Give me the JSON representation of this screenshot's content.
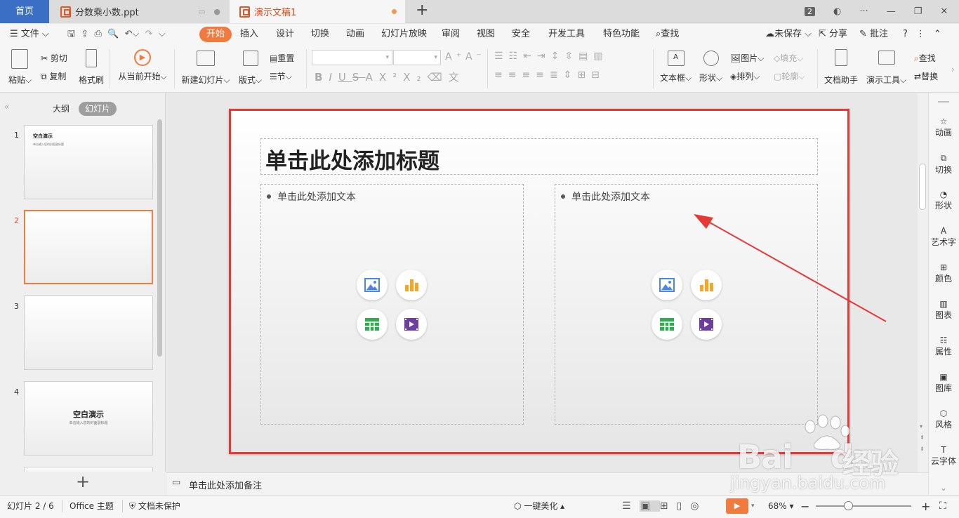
{
  "tabs": {
    "home": "首页",
    "doc1": "分数乘小数.ppt",
    "doc2": "演示文稿1",
    "badge": "2"
  },
  "menu": {
    "file": "文件",
    "items": [
      "开始",
      "插入",
      "设计",
      "切换",
      "动画",
      "幻灯片放映",
      "审阅",
      "视图",
      "安全",
      "开发工具",
      "特色功能"
    ],
    "search": "查找",
    "unsaved": "未保存",
    "share": "分享",
    "comment": "批注"
  },
  "ribbon": {
    "paste": "粘贴",
    "cut": "剪切",
    "copy": "复制",
    "format_painter": "格式刷",
    "from_current": "从当前开始",
    "new_slide": "新建幻灯片",
    "layout": "版式",
    "reset": "重置",
    "section": "节",
    "textbox": "文本框",
    "shape": "形状",
    "picture": "图片",
    "fill": "填充",
    "arrange": "排列",
    "outline": "轮廓",
    "doc_helper": "文档助手",
    "presenter_tools": "演示工具",
    "find": "查找",
    "replace": "替换"
  },
  "left_panel": {
    "outline_tab": "大纲",
    "slides_tab": "幻灯片",
    "slide_numbers": [
      "1",
      "2",
      "3",
      "4"
    ],
    "thumb1_title": "空白演示",
    "thumb1_sub": "单击输入您的封面副标题",
    "thumb4_title": "空白演示",
    "thumb4_sub": "单击输入您的封面副标题"
  },
  "slide": {
    "title_placeholder": "单击此处添加标题",
    "left_text": "单击此处添加文本",
    "right_text": "单击此处添加文本"
  },
  "notes_placeholder": "单击此处添加备注",
  "right_sidebar": [
    "动画",
    "切换",
    "形状",
    "艺术字",
    "颜色",
    "图表",
    "属性",
    "图库",
    "风格",
    "云字体"
  ],
  "status": {
    "slide_count": "幻灯片 2 / 6",
    "theme": "Office 主题",
    "protect": "文档未保护",
    "beautify": "一键美化",
    "zoom": "68%"
  },
  "watermark": {
    "brand": "Bai",
    "brand2": "du",
    "cn": "经验",
    "url": "jingyan.baidu.com"
  },
  "colors": {
    "accent": "#f07b3f",
    "home_tab": "#3b6fc6",
    "highlight": "#e53935"
  }
}
